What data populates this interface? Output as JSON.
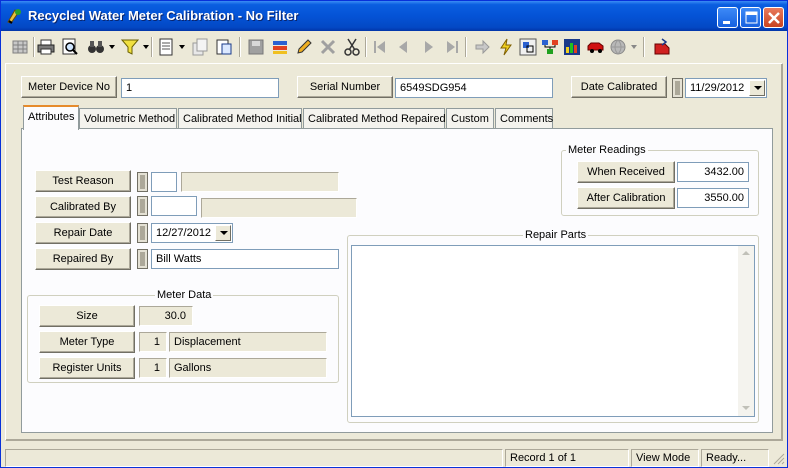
{
  "window": {
    "title": "Recycled Water Meter Calibration - No Filter",
    "icons": [
      "app-icon",
      "minimize-icon",
      "maximize-icon",
      "close-icon"
    ]
  },
  "toolbar": {
    "icons": [
      "grid-icon",
      "print-icon",
      "print-preview-icon",
      "binoculars-icon",
      "filter-icon",
      "new-record-icon",
      "copy-record-icon",
      "edit-record-icon",
      "disk-icon",
      "books-icon",
      "pencil-icon",
      "delete-icon",
      "cut-icon",
      "first-record-icon",
      "previous-record-icon",
      "next-record-icon",
      "last-record-icon",
      "goto-icon",
      "lightning-icon",
      "link-icon",
      "tree-icon",
      "chart-icon",
      "red-car-icon",
      "globe-icon",
      "exit-icon"
    ]
  },
  "header": {
    "meter_device_label": "Meter Device No",
    "meter_device_value": "1",
    "serial_label": "Serial Number",
    "serial_value": "6549SDG954",
    "date_calibrated_label": "Date Calibrated",
    "date_calibrated_value": "11/29/2012"
  },
  "tabs": [
    {
      "label": "Attributes",
      "active": true
    },
    {
      "label": "Volumetric Method"
    },
    {
      "label": "Calibrated Method Initial"
    },
    {
      "label": "Calibrated Method Repaired"
    },
    {
      "label": "Custom"
    },
    {
      "label": "Comments"
    }
  ],
  "attributes": {
    "test_reason_label": "Test Reason",
    "test_reason_code": "",
    "test_reason_desc": "",
    "calibrated_by_label": "Calibrated By",
    "calibrated_by_code": "",
    "calibrated_by_desc": "",
    "repair_date_label": "Repair Date",
    "repair_date_value": "12/27/2012",
    "repaired_by_label": "Repaired By",
    "repaired_by_value": "Bill Watts"
  },
  "meter_data": {
    "title": "Meter Data",
    "size_label": "Size",
    "size_value": "30.0",
    "meter_type_label": "Meter Type",
    "meter_type_code": "1",
    "meter_type_desc": "Displacement",
    "register_units_label": "Register Units",
    "register_units_code": "1",
    "register_units_desc": "Gallons"
  },
  "meter_readings": {
    "title": "Meter Readings",
    "when_received_label": "When Received",
    "when_received_value": "3432.00",
    "after_calibration_label": "After Calibration",
    "after_calibration_value": "3550.00"
  },
  "repair_parts": {
    "title": "Repair Parts",
    "text": ""
  },
  "status": {
    "record": "Record 1 of 1",
    "mode": "View Mode",
    "state": "Ready..."
  }
}
